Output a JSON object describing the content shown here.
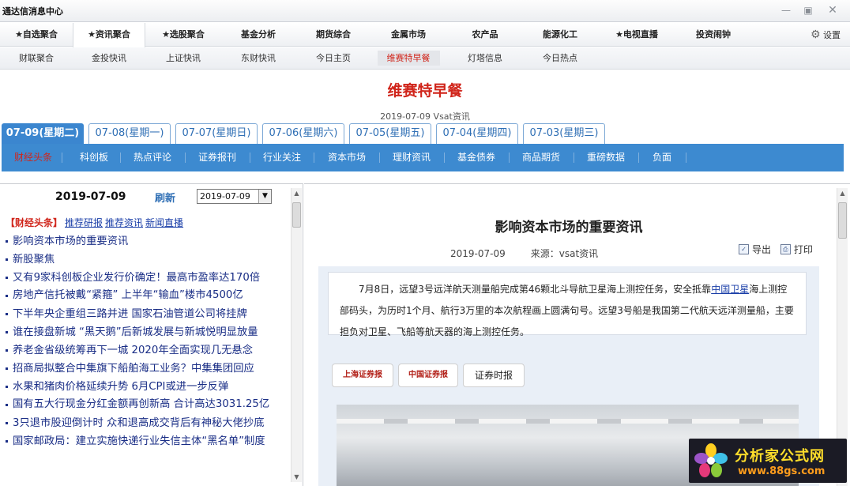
{
  "window": {
    "title": "通达信消息中心"
  },
  "nav1": {
    "items": [
      "★自选聚合",
      "★资讯聚合",
      "★选股聚合",
      "基金分析",
      "期货综合",
      "金属市场",
      "农产品",
      "能源化工",
      "★电视直播",
      "投资闹钟"
    ],
    "active_index": 1,
    "settings_label": "设置"
  },
  "nav2": {
    "items": [
      "财联聚合",
      "金投快讯",
      "上证快讯",
      "东财快讯",
      "今日主页",
      "维赛特早餐",
      "灯塔信息",
      "今日热点"
    ],
    "active_index": 5
  },
  "page": {
    "title": "维赛特早餐",
    "subtitle": "2019-07-09 Vsat资讯"
  },
  "date_tabs": {
    "items": [
      "07-09(星期二)",
      "07-08(星期一)",
      "07-07(星期日)",
      "07-06(星期六)",
      "07-05(星期五)",
      "07-04(星期四)",
      "07-03(星期三)"
    ],
    "active_index": 0
  },
  "categories": {
    "items": [
      "财经头条",
      "科创板",
      "热点评论",
      "证券报刊",
      "行业关注",
      "资本市场",
      "理财资讯",
      "基金债券",
      "商品期货",
      "重磅数据",
      "负面"
    ],
    "active_index": 0
  },
  "left": {
    "date": "2019-07-09",
    "refresh_label": "刷新",
    "date_select_value": "2019-07-09",
    "section_label": "【财经头条】",
    "section_links": [
      "推荐研报",
      "推荐资讯",
      "新闻直播"
    ],
    "news": [
      "影响资本市场的重要资讯",
      "新股聚焦",
      "又有9家科创板企业发行价确定！最高市盈率达170倍",
      "房地产信托被戴“紧箍” 上半年“输血”楼市4500亿",
      "下半年央企重组三路并进 国家石油管道公司将挂牌",
      "谁在接盘新城 “黑天鹅”后新城发展与新城悦明显放量",
      "养老金省级统筹再下一城 2020年全面实现几无悬念",
      "招商局拟整合中集旗下船舶海工业务？中集集团回应",
      "水果和猪肉价格延续升势 6月CPI或进一步反弹",
      "国有五大行现金分红金额再创新高 合计高达3031.25亿",
      "3只退市股迎倒计时 众和退高成交背后有神秘大佬抄底",
      "国家邮政局：建立实施快递行业失信主体“黑名单”制度"
    ]
  },
  "article": {
    "title": "影响资本市场的重要资讯",
    "date": "2019-07-09",
    "source": "来源：vsat资讯",
    "export_label": "导出",
    "print_label": "打印",
    "body_before": "7月8日，远望3号远洋航天测量船完成第46颗北斗导航卫星海上测控任务，安全抵靠",
    "body_link": "中国卫星",
    "body_after": "海上测控部码头，为历时1个月、航行3万里的本次航程画上圆满句号。远望3号船是我国第二代航天远洋测量船，主要担负对卫星、飞船等航天器的海上测控任务。",
    "logos": [
      "上海证券报",
      "中国证券报",
      "证券时报"
    ]
  },
  "ad": {
    "title": "分析家公式网",
    "url": "www.88gs.com"
  }
}
